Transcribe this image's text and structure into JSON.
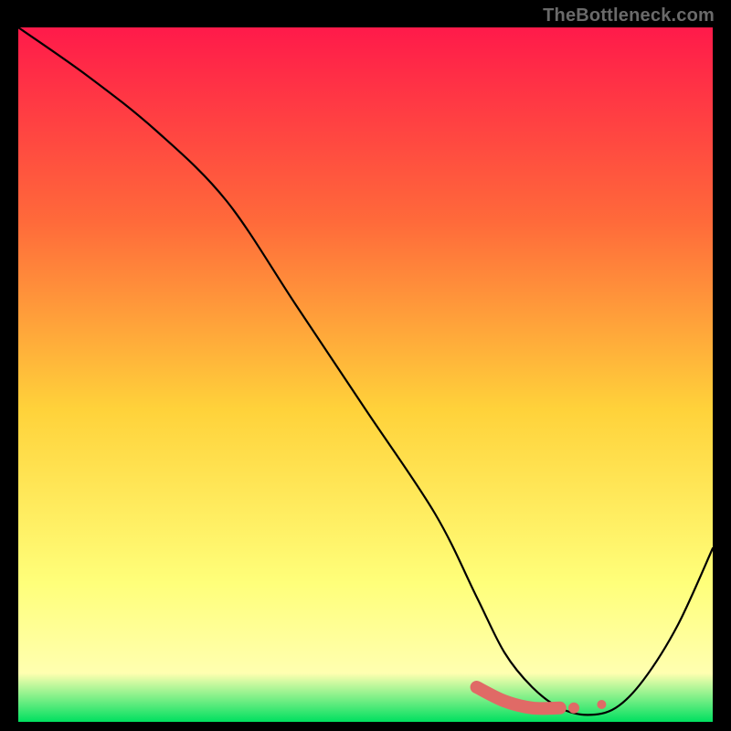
{
  "watermark": "TheBottleneck.com",
  "colors": {
    "frame_bg": "#000000",
    "grad_top": "#ff1a4a",
    "grad_mid_upper": "#ff6a3a",
    "grad_mid": "#ffd23a",
    "grad_mid_lower": "#ffff7a",
    "grad_yellow_pale": "#ffffb0",
    "grad_green": "#00e060",
    "curve_stroke": "#000000",
    "marker_fill": "#e06a66",
    "marker_stroke": "#e06a66"
  },
  "chart_data": {
    "type": "line",
    "title": "",
    "xlabel": "",
    "ylabel": "",
    "xlim": [
      0,
      100
    ],
    "ylim": [
      0,
      100
    ],
    "x": [
      0,
      10,
      20,
      30,
      40,
      50,
      60,
      66,
      70,
      74,
      78,
      82,
      86,
      90,
      95,
      100
    ],
    "values": [
      100,
      93,
      85,
      75,
      60,
      45,
      30,
      18,
      10,
      5,
      2,
      1,
      2,
      6,
      14,
      25
    ],
    "highlight_segment": {
      "x": [
        66,
        70,
        74,
        78
      ],
      "values": [
        5,
        3,
        2,
        2
      ]
    },
    "highlight_dots": {
      "x": [
        80,
        84
      ],
      "values": [
        2,
        2.5
      ]
    }
  }
}
